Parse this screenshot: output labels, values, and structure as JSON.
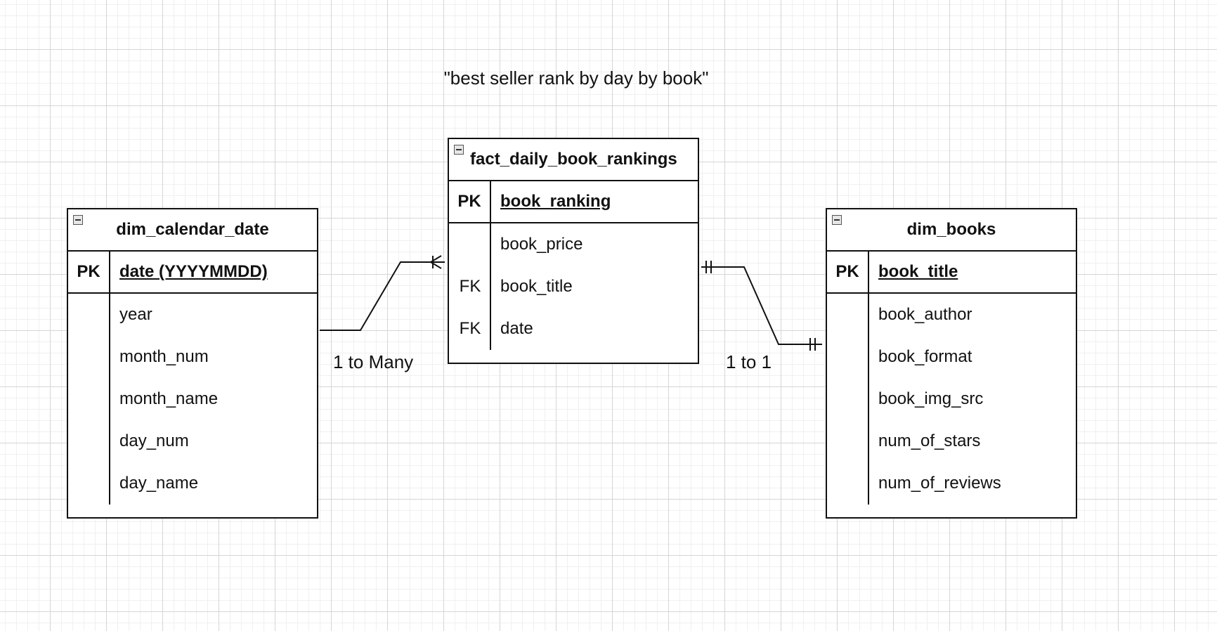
{
  "diagram": {
    "title": "\"best seller rank by day by book\"",
    "tables": {
      "calendar": {
        "name": "dim_calendar_date",
        "pk_key": "PK",
        "pk_name": "date (YYYYMMDD)",
        "fields": [
          {
            "key": "",
            "name": "year"
          },
          {
            "key": "",
            "name": "month_num"
          },
          {
            "key": "",
            "name": "month_name"
          },
          {
            "key": "",
            "name": "day_num"
          },
          {
            "key": "",
            "name": "day_name"
          }
        ]
      },
      "fact": {
        "name": "fact_daily_book_rankings",
        "pk_key": "PK",
        "pk_name": "book_ranking",
        "fields": [
          {
            "key": "",
            "name": "book_price"
          },
          {
            "key": "FK",
            "name": "book_title"
          },
          {
            "key": "FK",
            "name": "date"
          }
        ]
      },
      "books": {
        "name": "dim_books",
        "pk_key": "PK",
        "pk_name": "book_title",
        "fields": [
          {
            "key": "",
            "name": "book_author"
          },
          {
            "key": "",
            "name": "book_format"
          },
          {
            "key": "",
            "name": "book_img_src"
          },
          {
            "key": "",
            "name": "num_of_stars"
          },
          {
            "key": "",
            "name": "num_of_reviews"
          }
        ]
      }
    },
    "relationships": [
      {
        "label": "1 to Many",
        "from": "dim_calendar_date",
        "to": "fact_daily_book_rankings"
      },
      {
        "label": "1 to 1",
        "from": "fact_daily_book_rankings",
        "to": "dim_books"
      }
    ]
  }
}
